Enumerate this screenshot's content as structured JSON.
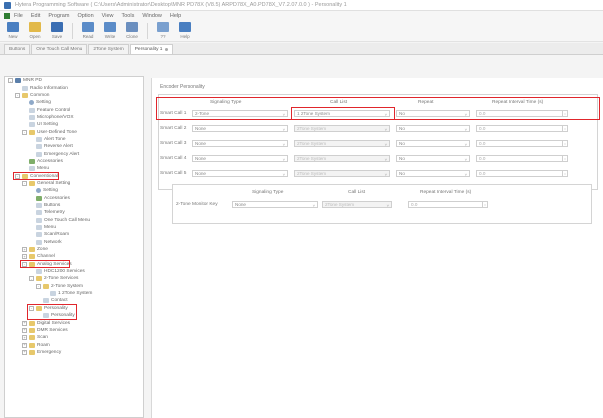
{
  "window": {
    "title": "Hytera Programming Software ( C:\\Users\\Administrator\\Desktop\\MNR PD78X (V8.5) ARPD78X_A0.PD78X_V7.2.07.0.0 ) - Personality 1"
  },
  "menu": {
    "items": [
      "File",
      "Edit",
      "Program",
      "Option",
      "View",
      "Tools",
      "Window",
      "Help"
    ]
  },
  "toolbar": {
    "buttons": [
      {
        "label": "New",
        "icon": "new-icon",
        "color": "#4a7fc1"
      },
      {
        "label": "Open",
        "icon": "open-icon",
        "color": "#e2b94a"
      },
      {
        "label": "Save",
        "icon": "save-icon",
        "color": "#3b6eb3"
      },
      {
        "label": "Read",
        "icon": "read-icon",
        "color": "#5b8cc8"
      },
      {
        "label": "Write",
        "icon": "write-icon",
        "color": "#5b8cc8"
      },
      {
        "label": "Clone",
        "icon": "clone-icon",
        "color": "#6b8fbf"
      },
      {
        "label": "??",
        "icon": "help-mark-icon",
        "color": "#7aa0cf"
      },
      {
        "label": "Help",
        "icon": "help-icon",
        "color": "#4a7fc1"
      }
    ]
  },
  "tabs": [
    {
      "label": "Buttons"
    },
    {
      "label": "One Touch Call Menu"
    },
    {
      "label": "2Tone System"
    },
    {
      "label": "Personality 1"
    }
  ],
  "tree": {
    "nodes": [
      {
        "label": "MNR PD",
        "indent": 0,
        "icon": "radio",
        "exp": "-"
      },
      {
        "label": "Radio Information",
        "indent": 1,
        "icon": "doc",
        "exp": ""
      },
      {
        "label": "Common",
        "indent": 1,
        "icon": "folder",
        "exp": "-"
      },
      {
        "label": "Setting",
        "indent": 2,
        "icon": "gear",
        "exp": ""
      },
      {
        "label": "Feature Control",
        "indent": 2,
        "icon": "doc",
        "exp": ""
      },
      {
        "label": "Microphone/VOX",
        "indent": 2,
        "icon": "doc",
        "exp": ""
      },
      {
        "label": "UI Setting",
        "indent": 2,
        "icon": "doc",
        "exp": ""
      },
      {
        "label": "User-Defined Tone",
        "indent": 2,
        "icon": "folder",
        "exp": "-"
      },
      {
        "label": "Alert Tone",
        "indent": 3,
        "icon": "doc",
        "exp": ""
      },
      {
        "label": "Reverse Alert",
        "indent": 3,
        "icon": "doc",
        "exp": ""
      },
      {
        "label": "Emergency Alert",
        "indent": 3,
        "icon": "doc",
        "exp": ""
      },
      {
        "label": "Accessories",
        "indent": 2,
        "icon": "green",
        "exp": ""
      },
      {
        "label": "Menu",
        "indent": 2,
        "icon": "doc",
        "exp": ""
      },
      {
        "label": "Conventional",
        "indent": 1,
        "icon": "folder",
        "exp": "-"
      },
      {
        "label": "General Setting",
        "indent": 2,
        "icon": "folder",
        "exp": "-"
      },
      {
        "label": "Setting",
        "indent": 3,
        "icon": "gear",
        "exp": ""
      },
      {
        "label": "Accessories",
        "indent": 3,
        "icon": "green",
        "exp": ""
      },
      {
        "label": "Buttons",
        "indent": 3,
        "icon": "doc",
        "exp": ""
      },
      {
        "label": "Telemetry",
        "indent": 3,
        "icon": "doc",
        "exp": ""
      },
      {
        "label": "One Touch Call Menu",
        "indent": 3,
        "icon": "doc",
        "exp": ""
      },
      {
        "label": "Menu",
        "indent": 3,
        "icon": "doc",
        "exp": ""
      },
      {
        "label": "Scan/Roam",
        "indent": 3,
        "icon": "doc",
        "exp": ""
      },
      {
        "label": "Network",
        "indent": 3,
        "icon": "doc",
        "exp": ""
      },
      {
        "label": "Zone",
        "indent": 2,
        "icon": "folder",
        "exp": "+"
      },
      {
        "label": "Channel",
        "indent": 2,
        "icon": "folder",
        "exp": "+"
      },
      {
        "label": "Analog Services",
        "indent": 2,
        "icon": "folder",
        "exp": "-"
      },
      {
        "label": "HDC1200 Services",
        "indent": 3,
        "icon": "doc",
        "exp": ""
      },
      {
        "label": "2-Tone Services",
        "indent": 3,
        "icon": "folder",
        "exp": "-"
      },
      {
        "label": "2-Tone System",
        "indent": 4,
        "icon": "folder",
        "exp": "-"
      },
      {
        "label": "1 2Tone System",
        "indent": 5,
        "icon": "doc",
        "exp": ""
      },
      {
        "label": "Contact",
        "indent": 4,
        "icon": "doc",
        "exp": ""
      },
      {
        "label": "Personality",
        "indent": 3,
        "icon": "folder",
        "exp": "-"
      },
      {
        "label": "Personality",
        "indent": 4,
        "icon": "doc",
        "exp": ""
      },
      {
        "label": "Digital Services",
        "indent": 2,
        "icon": "folder",
        "exp": "+"
      },
      {
        "label": "DMR Services",
        "indent": 2,
        "icon": "folder",
        "exp": "+"
      },
      {
        "label": "Scan",
        "indent": 2,
        "icon": "folder",
        "exp": "+"
      },
      {
        "label": "Roam",
        "indent": 2,
        "icon": "folder",
        "exp": "+"
      },
      {
        "label": "Emergency",
        "indent": 2,
        "icon": "folder",
        "exp": "+"
      }
    ]
  },
  "encoder": {
    "section_title": "Encoder Personality",
    "headers": {
      "signaling_type": "Signaling Type",
      "call_list": "Call List",
      "repeat": "Repeat",
      "repeat_interval": "Repeat Interval Time (s)"
    },
    "rows": [
      {
        "label": "Smart Call 1",
        "signaling_type": "2-Tone",
        "call_list": "1 2Tone System",
        "repeat": "No",
        "interval": "0.0",
        "call_list_disabled": false
      },
      {
        "label": "Smart Call 2",
        "signaling_type": "None",
        "call_list": "2Tone System",
        "repeat": "No",
        "interval": "0.0",
        "call_list_disabled": true
      },
      {
        "label": "Smart Call 3",
        "signaling_type": "None",
        "call_list": "2Tone System",
        "repeat": "No",
        "interval": "0.0",
        "call_list_disabled": true
      },
      {
        "label": "Smart Call 4",
        "signaling_type": "None",
        "call_list": "2Tone System",
        "repeat": "No",
        "interval": "0.0",
        "call_list_disabled": true
      },
      {
        "label": "Smart Call 5",
        "signaling_type": "None",
        "call_list": "2Tone System",
        "repeat": "No",
        "interval": "0.0",
        "call_list_disabled": true
      }
    ]
  },
  "secondary": {
    "headers": {
      "signaling_type": "Signaling Type",
      "call_list": "Call List",
      "repeat_interval": "Repeat Interval Time (s)"
    },
    "row": {
      "label": "2-Tone Monitor Key",
      "signaling_type": "None",
      "call_list": "2Tone System",
      "interval": "0.0"
    }
  },
  "colors": {
    "highlight": "#e0262c"
  }
}
